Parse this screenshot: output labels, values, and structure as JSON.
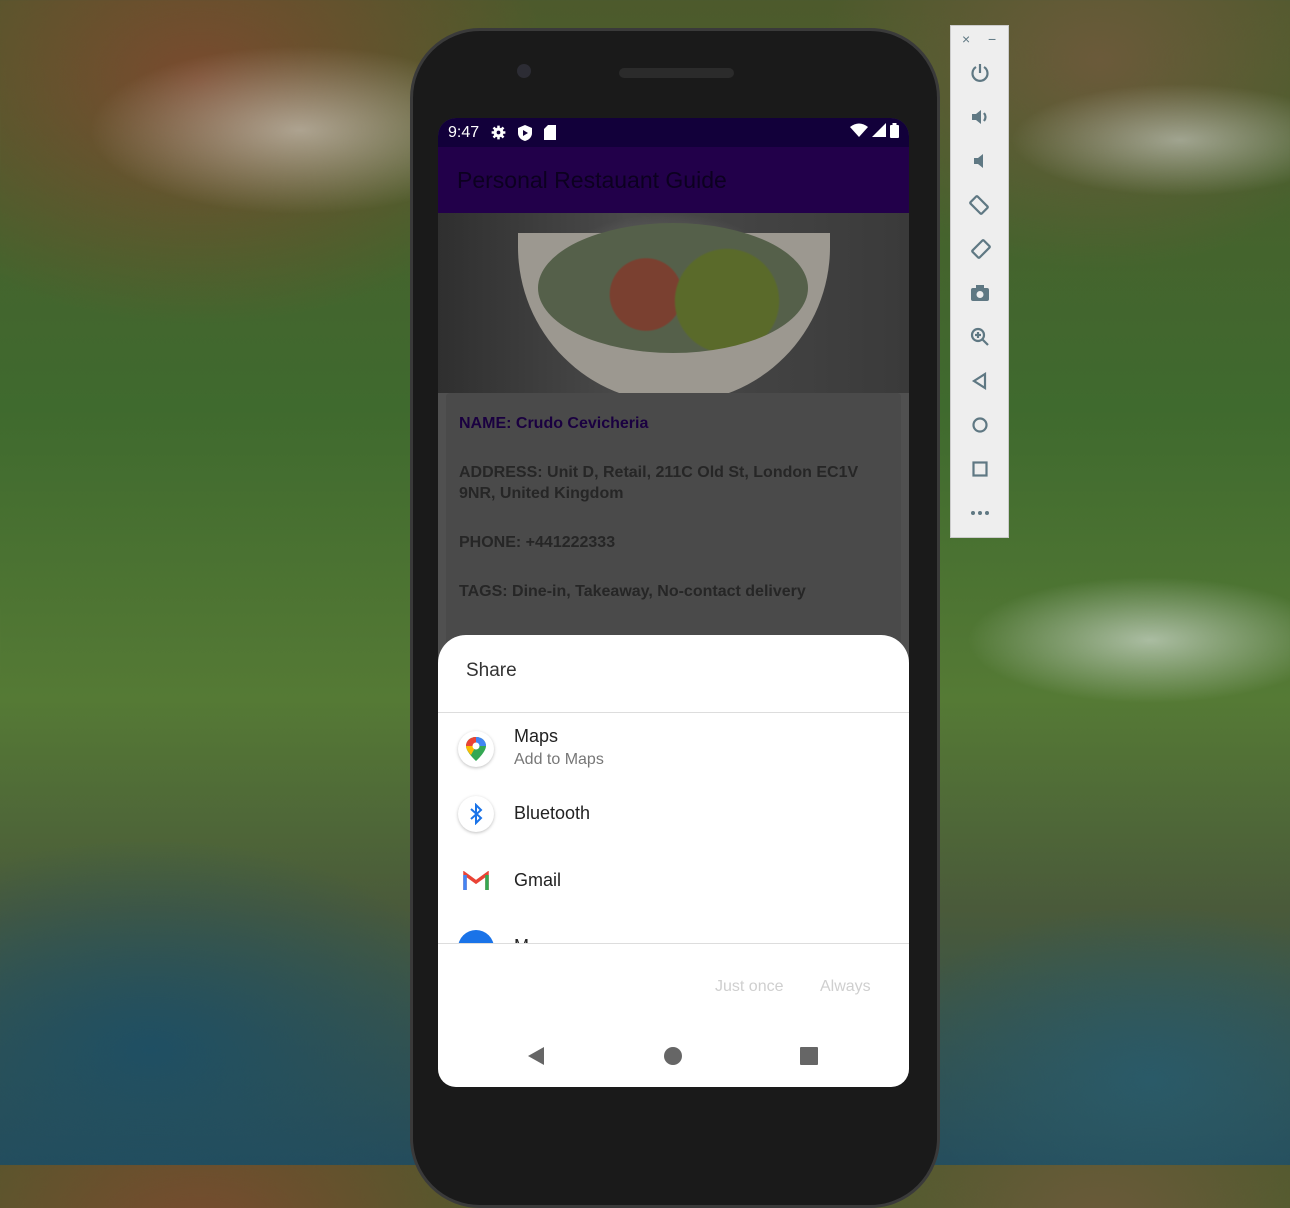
{
  "status_bar": {
    "time": "9:47",
    "icons": [
      "settings-icon",
      "shield-play-icon",
      "sd-card-icon",
      "wifi-icon",
      "signal-icon",
      "battery-icon"
    ]
  },
  "app_bar": {
    "title": "Personal Restauant Guide"
  },
  "restaurant": {
    "name": "NAME: Crudo Cevicheria",
    "address": "ADDRESS: Unit D, Retail, 211C Old St, London EC1V 9NR, United Kingdom",
    "phone": "PHONE: +441222333",
    "tags": "TAGS: Dine-in, Takeaway, No-contact delivery"
  },
  "share_sheet": {
    "title": "Share",
    "items": [
      {
        "label": "Maps",
        "sublabel": "Add to Maps",
        "icon": "google-maps-icon"
      },
      {
        "label": "Bluetooth",
        "icon": "bluetooth-icon"
      },
      {
        "label": "Gmail",
        "icon": "gmail-icon"
      },
      {
        "label": "M",
        "icon": "messages-icon"
      }
    ],
    "just_once": "Just once",
    "always": "Always"
  },
  "nav_bar": {
    "icons": [
      "back-icon",
      "home-icon",
      "recents-icon"
    ]
  },
  "emulator_toolbar": {
    "close": "×",
    "minimize": "−",
    "icons": [
      "power-icon",
      "volume-up-icon",
      "volume-down-icon",
      "rotate-left-icon",
      "rotate-right-icon",
      "screenshot-icon",
      "zoom-icon",
      "back-icon",
      "home-icon",
      "overview-icon",
      "more-icon"
    ]
  },
  "colors": {
    "status_bar": "#12003a",
    "app_bar": "#22004a",
    "toolbar_icon": "#5f7883"
  }
}
